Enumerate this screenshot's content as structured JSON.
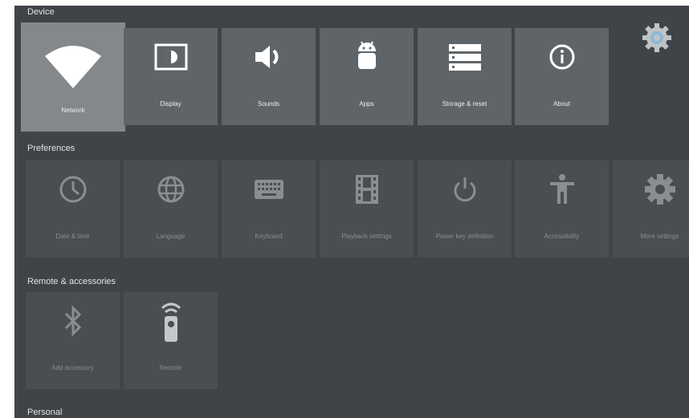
{
  "sections": {
    "device": "Device",
    "preferences": "Preferences",
    "remote": "Remote & accessories",
    "personal": "Personal"
  },
  "device_tiles": [
    {
      "label": "Network",
      "icon": "wifi-icon"
    },
    {
      "label": "Display",
      "icon": "display-icon"
    },
    {
      "label": "Sounds",
      "icon": "speaker-icon"
    },
    {
      "label": "Apps",
      "icon": "android-icon"
    },
    {
      "label": "Storage & reset",
      "icon": "storage-icon"
    },
    {
      "label": "About",
      "icon": "info-icon"
    }
  ],
  "preference_tiles": [
    {
      "label": "Date & time",
      "icon": "clock-icon"
    },
    {
      "label": "Language",
      "icon": "globe-icon"
    },
    {
      "label": "Keyboard",
      "icon": "keyboard-icon"
    },
    {
      "label": "Playback settings",
      "icon": "film-icon"
    },
    {
      "label": "Power key definition",
      "icon": "power-icon"
    },
    {
      "label": "Accessibility",
      "icon": "accessibility-icon"
    },
    {
      "label": "More settings",
      "icon": "gear-icon"
    }
  ],
  "remote_tiles": [
    {
      "label": "Add accessory",
      "icon": "bluetooth-icon"
    },
    {
      "label": "Remote",
      "icon": "remote-icon"
    }
  ],
  "colors": {
    "background": "#3f4449",
    "tile": "#5f6468",
    "tile_dim": "#4a4e52",
    "tile_focused": "#84888b",
    "accent": "#8ab7d8"
  }
}
